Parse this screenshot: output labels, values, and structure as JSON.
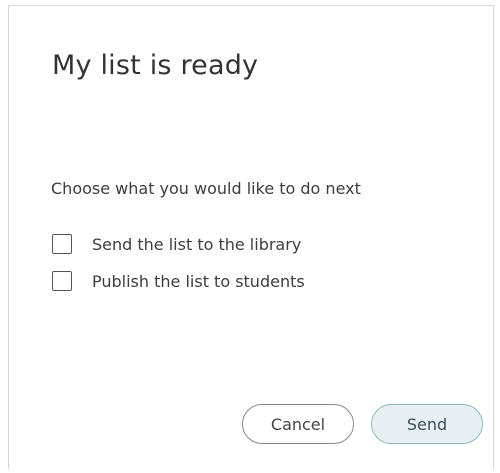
{
  "dialog": {
    "title": "My list is ready",
    "prompt": "Choose what you would like to do next",
    "options": [
      {
        "label": "Send the list to the library",
        "checked": false
      },
      {
        "label": "Publish the list to students",
        "checked": false
      }
    ],
    "buttons": {
      "cancel_label": "Cancel",
      "send_label": "Send"
    }
  },
  "colors": {
    "send_button_bg": "#e6f0f2",
    "send_button_border": "#8fb8c4",
    "text": "#3d3d3d"
  }
}
